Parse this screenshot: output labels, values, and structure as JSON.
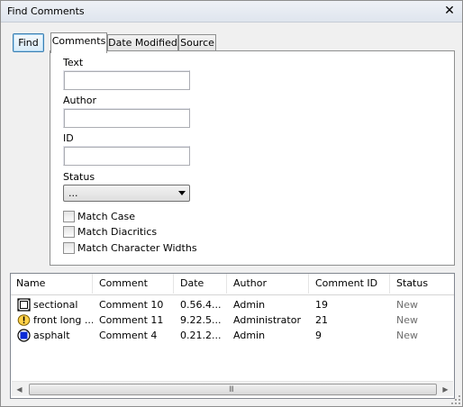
{
  "window": {
    "title": "Find Comments"
  },
  "toolbar": {
    "find_label": "Find"
  },
  "tabs": [
    {
      "label": "Comments",
      "active": true
    },
    {
      "label": "Date Modified",
      "active": false
    },
    {
      "label": "Source",
      "active": false
    }
  ],
  "form": {
    "text_label": "Text",
    "text_value": "",
    "author_label": "Author",
    "author_value": "",
    "id_label": "ID",
    "id_value": "",
    "status_label": "Status",
    "status_value": "...",
    "checkboxes": [
      {
        "label": "Match Case",
        "checked": false
      },
      {
        "label": "Match Diacritics",
        "checked": false
      },
      {
        "label": "Match Character Widths",
        "checked": false
      }
    ]
  },
  "results": {
    "columns": [
      "Name",
      "Comment",
      "Date",
      "Author",
      "Comment ID",
      "Status"
    ],
    "rows": [
      {
        "icon": "film-frame-icon",
        "name": "sectional",
        "comment": "Comment 10",
        "date": "0.56.4...",
        "author": "Admin",
        "comment_id": "19",
        "status": "New"
      },
      {
        "icon": "warning-circle-icon",
        "name": "front long ...",
        "comment": "Comment 11",
        "date": "9.22.5...",
        "author": "Administrator",
        "comment_id": "21",
        "status": "New"
      },
      {
        "icon": "blue-square-circle-icon",
        "name": "asphalt",
        "comment": "Comment 4",
        "date": "0.21.2...",
        "author": "Admin",
        "comment_id": "9",
        "status": "New"
      }
    ]
  },
  "colors": {
    "accent": "#3c7fb1",
    "status_text": "#6d6d6d",
    "panel_bg": "#f0f0f0"
  }
}
